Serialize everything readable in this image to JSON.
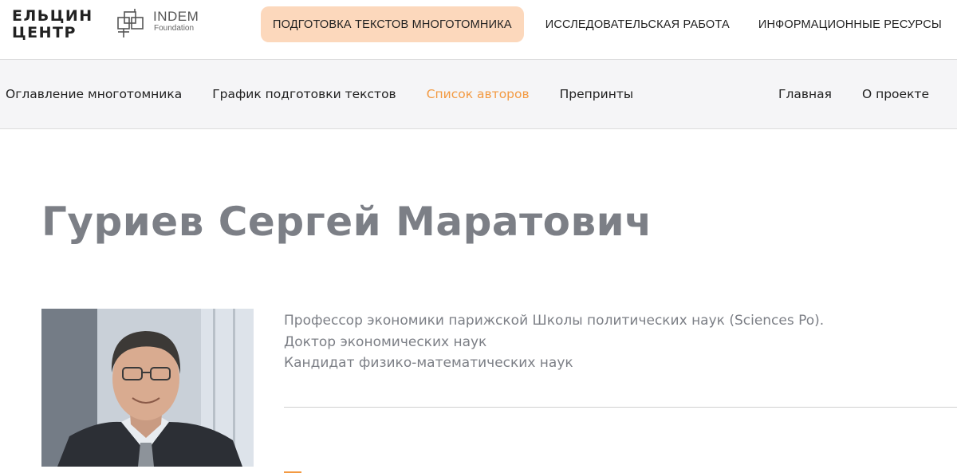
{
  "header": {
    "logo_yeltsin_line1": "ЕЛЬЦИН",
    "logo_yeltsin_line2": "ЦЕНТР",
    "logo_indem_title": "INDEM",
    "logo_indem_sub": "Foundation",
    "nav": [
      {
        "label": "ПОДГОТОВКА ТЕКСТОВ МНОГОТОМНИКА",
        "active": true
      },
      {
        "label": "ИССЛЕДОВАТЕЛЬСКАЯ РАБОТА",
        "active": false
      },
      {
        "label": "ИНФОРМАЦИОННЫЕ РЕСУРСЫ",
        "active": false
      }
    ]
  },
  "subnav": {
    "left": [
      {
        "label": "Оглавление многотомника",
        "active": false
      },
      {
        "label": "График подготовки текстов",
        "active": false
      },
      {
        "label": "Список авторов",
        "active": true
      },
      {
        "label": "Препринты",
        "active": false
      }
    ],
    "right": [
      {
        "label": "Главная"
      },
      {
        "label": "О проекте"
      }
    ]
  },
  "author": {
    "name": "Гуриев Сергей Маратович",
    "bio": [
      "Профессор экономики парижской Школы политических наук (Sciences Po).",
      "Доктор экономических наук",
      "Кандидат физико-математических наук"
    ]
  },
  "colors": {
    "accent": "#f39a42",
    "active_tab_bg": "#fcd8bc",
    "title_gray": "#7c7f86"
  }
}
